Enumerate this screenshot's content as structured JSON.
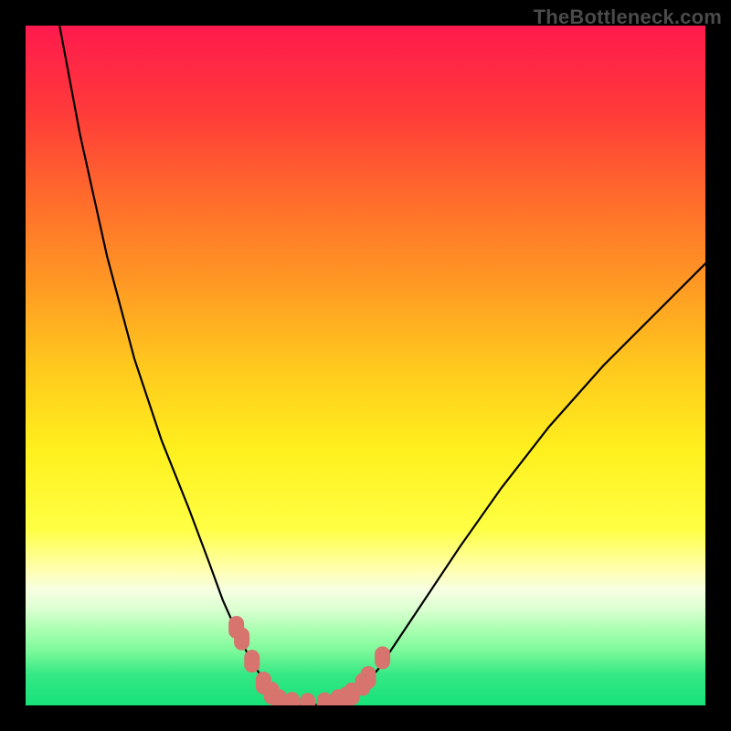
{
  "watermark": {
    "text": "TheBottleneck.com"
  },
  "colors": {
    "bg": "#000000",
    "curve": "#000000",
    "marker": "#d6746d",
    "gradient_stops": [
      {
        "offset": 0.0,
        "color": "#ff1a4e"
      },
      {
        "offset": 0.125,
        "color": "#ff3a3a"
      },
      {
        "offset": 0.25,
        "color": "#ff6a2c"
      },
      {
        "offset": 0.375,
        "color": "#ff9724"
      },
      {
        "offset": 0.5,
        "color": "#ffc81e"
      },
      {
        "offset": 0.625,
        "color": "#fff01e"
      },
      {
        "offset": 0.74,
        "color": "#ffff44"
      },
      {
        "offset": 0.8,
        "color": "#ffffb0"
      },
      {
        "offset": 0.83,
        "color": "#f7ffe2"
      },
      {
        "offset": 0.86,
        "color": "#d9ffd0"
      },
      {
        "offset": 0.89,
        "color": "#a8ffb0"
      },
      {
        "offset": 0.92,
        "color": "#7cf99a"
      },
      {
        "offset": 0.955,
        "color": "#34e884"
      },
      {
        "offset": 1.0,
        "color": "#18e17a"
      }
    ]
  },
  "chart_data": {
    "type": "line",
    "title": "",
    "xlabel": "",
    "ylabel": "",
    "xlim": [
      0,
      100
    ],
    "ylim": [
      0,
      100
    ],
    "grid": false,
    "legend": false,
    "series": [
      {
        "name": "left-curve",
        "x": [
          5,
          8,
          12,
          16,
          20,
          24,
          27,
          29,
          31,
          32.7,
          34.2,
          35.4,
          36.5,
          37.5
        ],
        "y": [
          100,
          84,
          66,
          51,
          39,
          29,
          21,
          15.5,
          11,
          7.5,
          5,
          2.9,
          1.4,
          0.5
        ]
      },
      {
        "name": "floor",
        "x": [
          37.5,
          39,
          41,
          43,
          45,
          47
        ],
        "y": [
          0.5,
          0.1,
          0.03,
          0.07,
          0.3,
          0.8
        ]
      },
      {
        "name": "right-curve",
        "x": [
          47,
          49.3,
          52,
          55,
          59,
          64,
          70,
          77,
          85,
          93,
          100
        ],
        "y": [
          0.8,
          2.3,
          5.5,
          10,
          16,
          23.5,
          32,
          41,
          50,
          58,
          65
        ]
      }
    ],
    "markers": [
      {
        "name": "left-upper-1",
        "x": 31.0,
        "y": 11.5
      },
      {
        "name": "left-upper-2",
        "x": 31.8,
        "y": 9.8
      },
      {
        "name": "left-mid",
        "x": 33.3,
        "y": 6.5
      },
      {
        "name": "left-lower-1",
        "x": 35.0,
        "y": 3.3
      },
      {
        "name": "left-lower-2",
        "x": 36.2,
        "y": 1.8
      },
      {
        "name": "floor-1",
        "x": 37.3,
        "y": 0.7
      },
      {
        "name": "floor-2",
        "x": 39.2,
        "y": 0.3
      },
      {
        "name": "floor-3",
        "x": 41.5,
        "y": 0.15
      },
      {
        "name": "floor-4",
        "x": 44.0,
        "y": 0.25
      },
      {
        "name": "floor-5",
        "x": 46.0,
        "y": 0.7
      },
      {
        "name": "right-lower-1",
        "x": 47.2,
        "y": 1.1
      },
      {
        "name": "right-lower-2",
        "x": 48.0,
        "y": 1.7
      },
      {
        "name": "right-mid-1",
        "x": 49.6,
        "y": 3.1
      },
      {
        "name": "right-mid-2",
        "x": 50.4,
        "y": 4.1
      },
      {
        "name": "right-upper",
        "x": 52.5,
        "y": 7.0
      }
    ]
  }
}
